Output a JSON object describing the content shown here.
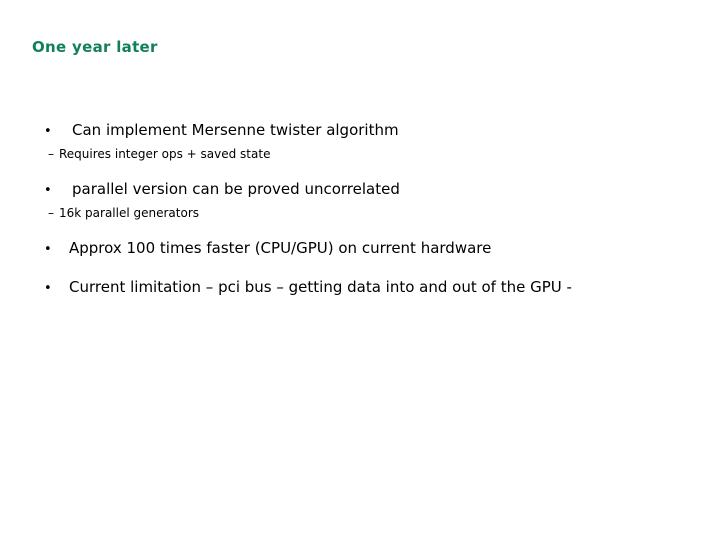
{
  "slide": {
    "title": "One year later",
    "title_color": "#12815A",
    "background_color": "#ffffff",
    "text_color": "#000000",
    "bullets": [
      {
        "marker": "•",
        "text": "Can implement Mersenne twister algorithm",
        "level": 1,
        "sub": [
          {
            "marker": "–",
            "text": "Requires integer ops + saved state",
            "level": 2
          }
        ]
      },
      {
        "marker": "•",
        "text": "parallel version can be proved uncorrelated",
        "level": 1,
        "sub": [
          {
            "marker": "–",
            "text": "16k parallel generators",
            "level": 2
          }
        ]
      },
      {
        "marker": "•",
        "text": "Approx 100 times faster (CPU/GPU)  on current hardware",
        "level": 1,
        "sub": []
      },
      {
        "marker": "•",
        "text": "Current limitation – pci bus – getting data into and out of the GPU -",
        "level": 1,
        "sub": []
      }
    ]
  }
}
